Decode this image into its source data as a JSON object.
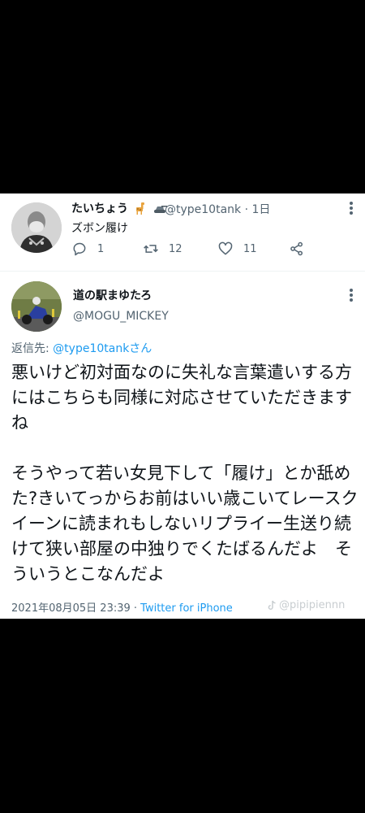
{
  "tweet1": {
    "author_name": "たいちょう",
    "handle": "@type10tank",
    "separator": "·",
    "time": "1日",
    "text": "ズボン履け",
    "reply_count": "1",
    "retweet_count": "12",
    "like_count": "11"
  },
  "tweet2": {
    "author_name": "道の駅まゆたろ",
    "handle": "@MOGU_MICKEY",
    "reply_prefix": "返信先: ",
    "reply_mention": "@type10tankさん",
    "body": "悪いけど初対面なのに失礼な言葉遣いする方にはこちらも同様に対応させていただきますね\n\nそうやって若い女見下して「履け」とか舐めた?きいてっからお前はいい歳こいてレースクイーンに読まれもしないリプライー生送り続けて狭い部屋の中独りでくたばるんだよ　そういうとこなんだよ",
    "timestamp": "2021年08月05日 23:39",
    "separator": " · ",
    "source": "Twitter for iPhone"
  },
  "watermark": {
    "text": "@pipipiennn",
    "icon": "tiktok-icon"
  },
  "colors": {
    "link": "#1d9bf0",
    "muted": "#536471",
    "background": "#000000",
    "card": "#ffffff"
  }
}
